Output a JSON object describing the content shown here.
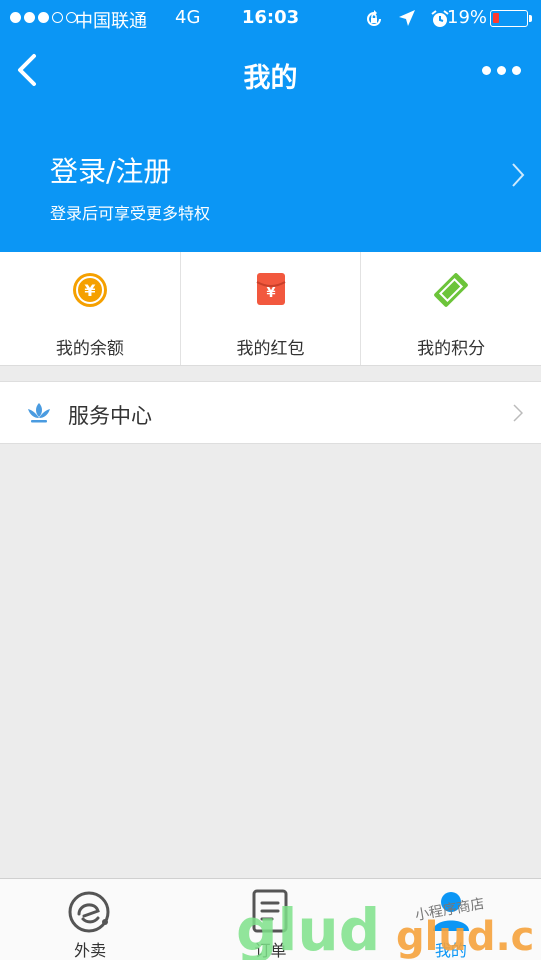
{
  "status_bar": {
    "carrier": "中国联通",
    "network": "4G",
    "time": "16:03",
    "battery_percent": "19%",
    "battery_level": 0.19,
    "signal_bars_filled": 3,
    "signal_bars_total": 5,
    "icons": [
      "rotation-lock-icon",
      "location-arrow-icon",
      "alarm-icon",
      "battery-icon"
    ]
  },
  "navbar": {
    "title": "我的",
    "back_icon": "chevron-left-icon",
    "more_icon": "more-dots-icon"
  },
  "login": {
    "title": "登录/注册",
    "subtitle": "登录后可享受更多特权"
  },
  "assets": [
    {
      "label": "我的余额",
      "icon": "yuan-coin-icon",
      "color": "#f5a000"
    },
    {
      "label": "我的红包",
      "icon": "red-envelope-icon",
      "color": "#f2583e"
    },
    {
      "label": "我的积分",
      "icon": "points-ticket-icon",
      "color": "#6cc43a"
    }
  ],
  "service": {
    "label": "服务中心",
    "icon": "lotus-icon"
  },
  "tabbar": [
    {
      "label": "外卖",
      "icon": "eleme-logo-icon",
      "active": false
    },
    {
      "label": "订单",
      "icon": "order-list-icon",
      "active": false
    },
    {
      "label": "我的",
      "icon": "user-icon",
      "active": true
    }
  ],
  "watermark": {
    "text": "glud.com",
    "script": "小程序商店"
  },
  "colors": {
    "primary": "#0b96f5",
    "background": "#ececec",
    "battery_low": "#ff3b30"
  }
}
